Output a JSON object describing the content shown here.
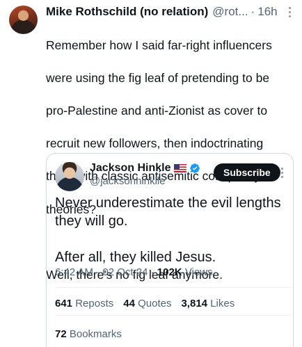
{
  "tweet": {
    "author_name": "Mike Rothschild (no relation)",
    "author_handle": "@rot...",
    "dot": "·",
    "time": "16h",
    "lines": [
      "Remember how I said far-right influencers",
      "were using the fig leaf of pretending to be",
      "pro-Palestine and anti-Zionist as cover to",
      "recruit new followers, then indoctrinating",
      "them with classic antisemitic conspiracy",
      "theories?",
      "",
      "Well, there's no fig leaf anymore."
    ]
  },
  "quote": {
    "author_name": "Jackson Hinkle",
    "author_handle": "@jacksonhinklle",
    "flag_icon": "us-flag-icon",
    "verified_icon": "verified-badge-icon",
    "subscribe_label": "Subscribe",
    "text_line1": "Never underestimate the evil lengths",
    "text_line2": "they will go.",
    "text_line3": "After all, they killed Jesus.",
    "time": "6:42 AM",
    "dot1": "·",
    "date": "02 Oct 24",
    "dot2": "·",
    "views_count": "102K",
    "views_label": "Views",
    "reposts_count": "641",
    "reposts_label": "Reposts",
    "quotes_count": "44",
    "quotes_label": "Quotes",
    "likes_count": "3,814",
    "likes_label": "Likes",
    "bookmarks_count": "72",
    "bookmarks_label": "Bookmarks"
  },
  "colors": {
    "text": "#0f1419",
    "secondary": "#536471",
    "border": "#cfd9de",
    "verified": "#1d9bf0"
  }
}
